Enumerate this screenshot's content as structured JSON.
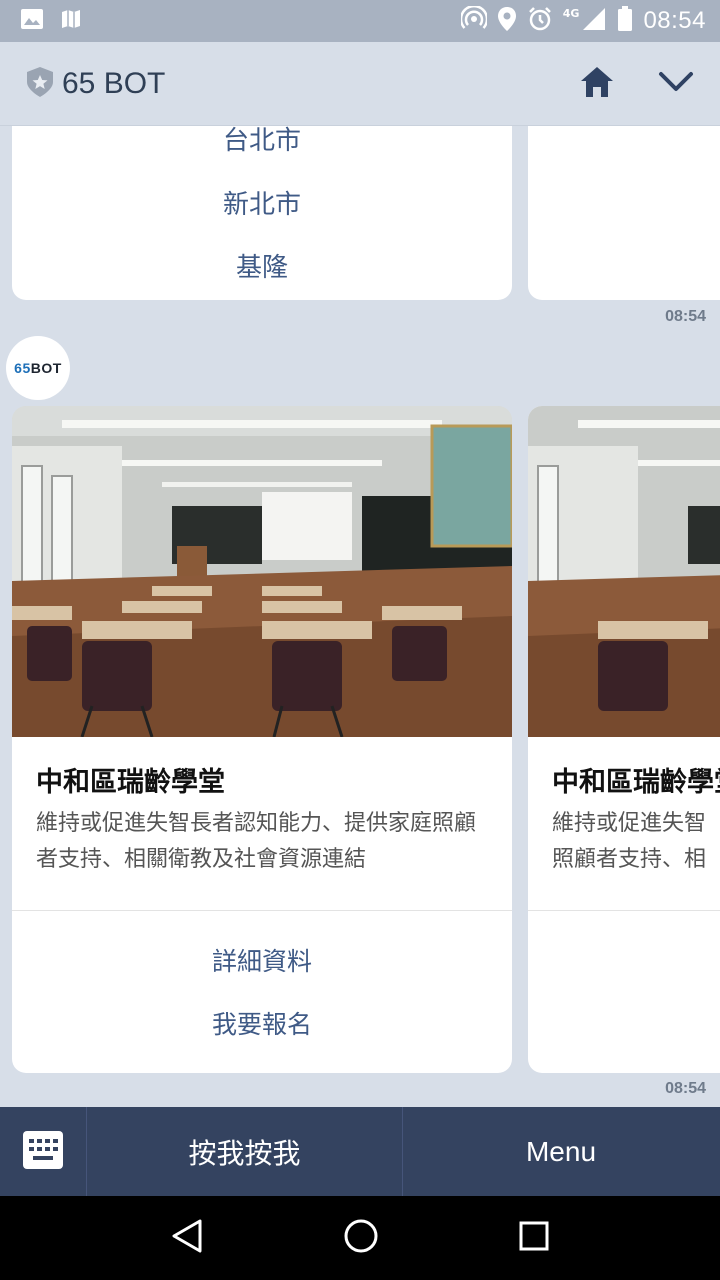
{
  "status_bar": {
    "time": "08:54",
    "network": "4G",
    "icons": [
      "image-icon",
      "map-icon",
      "hotspot-icon",
      "location-icon",
      "alarm-icon",
      "signal-icon",
      "battery-icon"
    ]
  },
  "header": {
    "title": "65 BOT",
    "icons": [
      "shield-star-icon",
      "home-icon",
      "chevron-down-icon"
    ]
  },
  "messages": {
    "first_card": {
      "cities": [
        "台北市",
        "新北市",
        "基隆"
      ],
      "timestamp": "08:54"
    },
    "avatar": {
      "num": "65",
      "text": "BOT"
    },
    "carousel_card": {
      "title": "中和區瑞齡學堂",
      "description": "維持或促進失智長者認知能力、提供家庭照顧者支持、相關衛教及社會資源連結",
      "description_peek_line1": "維持或促進失智",
      "description_peek_line2": "照顧者支持、相",
      "actions": [
        "詳細資料",
        "我要報名"
      ],
      "timestamp": "08:54"
    }
  },
  "rich_menu": {
    "button_1": "按我按我",
    "button_2": "Menu"
  },
  "colors": {
    "status_bar": "#a8b2c1",
    "background": "#d7dee8",
    "link": "#3f5a86",
    "rich_menu": "#344360",
    "header_icon": "#2f4263"
  }
}
